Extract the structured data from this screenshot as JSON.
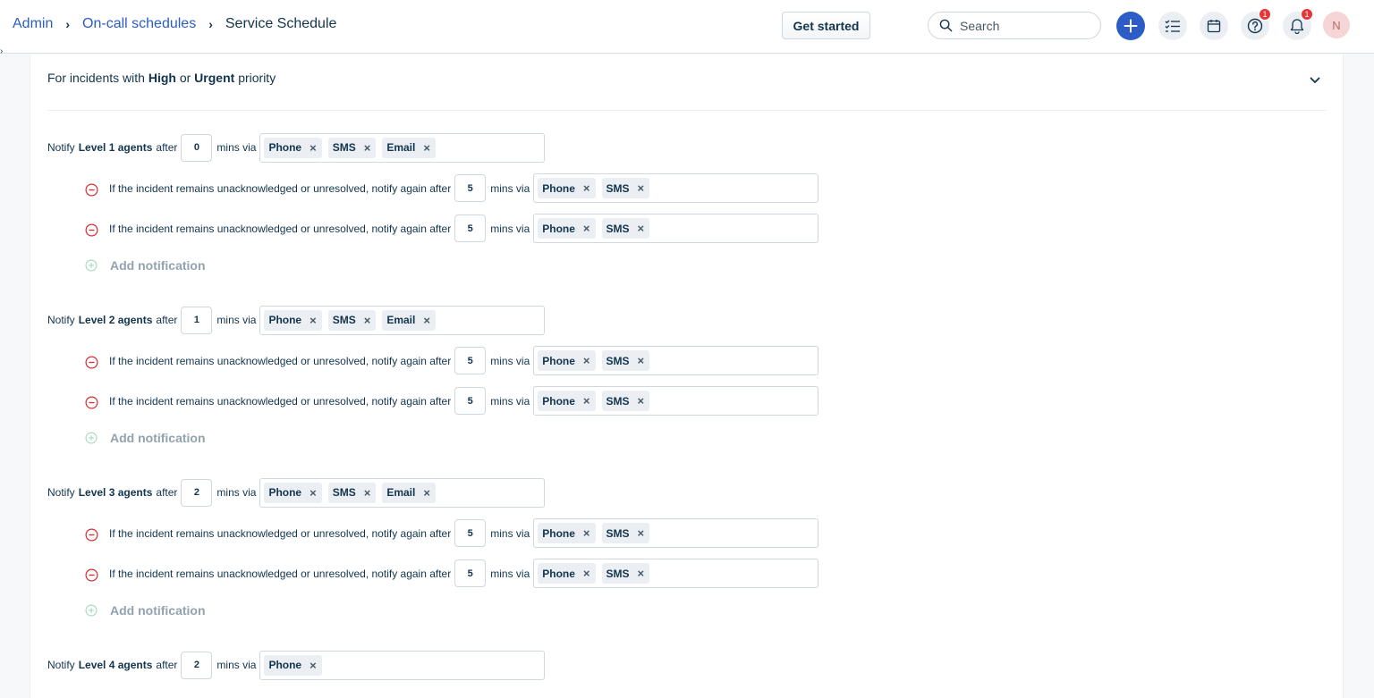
{
  "breadcrumb": {
    "admin": "Admin",
    "schedules": "On-call schedules",
    "current": "Service Schedule",
    "separator": "›"
  },
  "header": {
    "get_started": "Get started",
    "search_placeholder": "Search",
    "help_badge": "1",
    "notif_badge": "1",
    "avatar_initial": "N"
  },
  "section": {
    "prefix": "For incidents with",
    "high": "High",
    "or": "or",
    "urgent": "Urgent",
    "suffix": "priority"
  },
  "text": {
    "notify": "Notify",
    "after": "after",
    "mins_via": "mins via",
    "again": "If the incident remains unacknowledged or unresolved, notify again after",
    "add_notification": "Add notification",
    "chip_close": "×"
  },
  "levels": [
    {
      "label": "Level 1 agents",
      "delay": "0",
      "channels": [
        "Phone",
        "SMS",
        "Email"
      ],
      "repeats": [
        {
          "delay": "5",
          "channels": [
            "Phone",
            "SMS"
          ]
        },
        {
          "delay": "5",
          "channels": [
            "Phone",
            "SMS"
          ]
        }
      ]
    },
    {
      "label": "Level 2 agents",
      "delay": "1",
      "channels": [
        "Phone",
        "SMS",
        "Email"
      ],
      "repeats": [
        {
          "delay": "5",
          "channels": [
            "Phone",
            "SMS"
          ]
        },
        {
          "delay": "5",
          "channels": [
            "Phone",
            "SMS"
          ]
        }
      ]
    },
    {
      "label": "Level 3 agents",
      "delay": "2",
      "channels": [
        "Phone",
        "SMS",
        "Email"
      ],
      "repeats": [
        {
          "delay": "5",
          "channels": [
            "Phone",
            "SMS"
          ]
        },
        {
          "delay": "5",
          "channels": [
            "Phone",
            "SMS"
          ]
        }
      ]
    },
    {
      "label": "Level 4 agents",
      "delay": "2",
      "channels": [
        "Phone"
      ],
      "repeats": []
    }
  ]
}
